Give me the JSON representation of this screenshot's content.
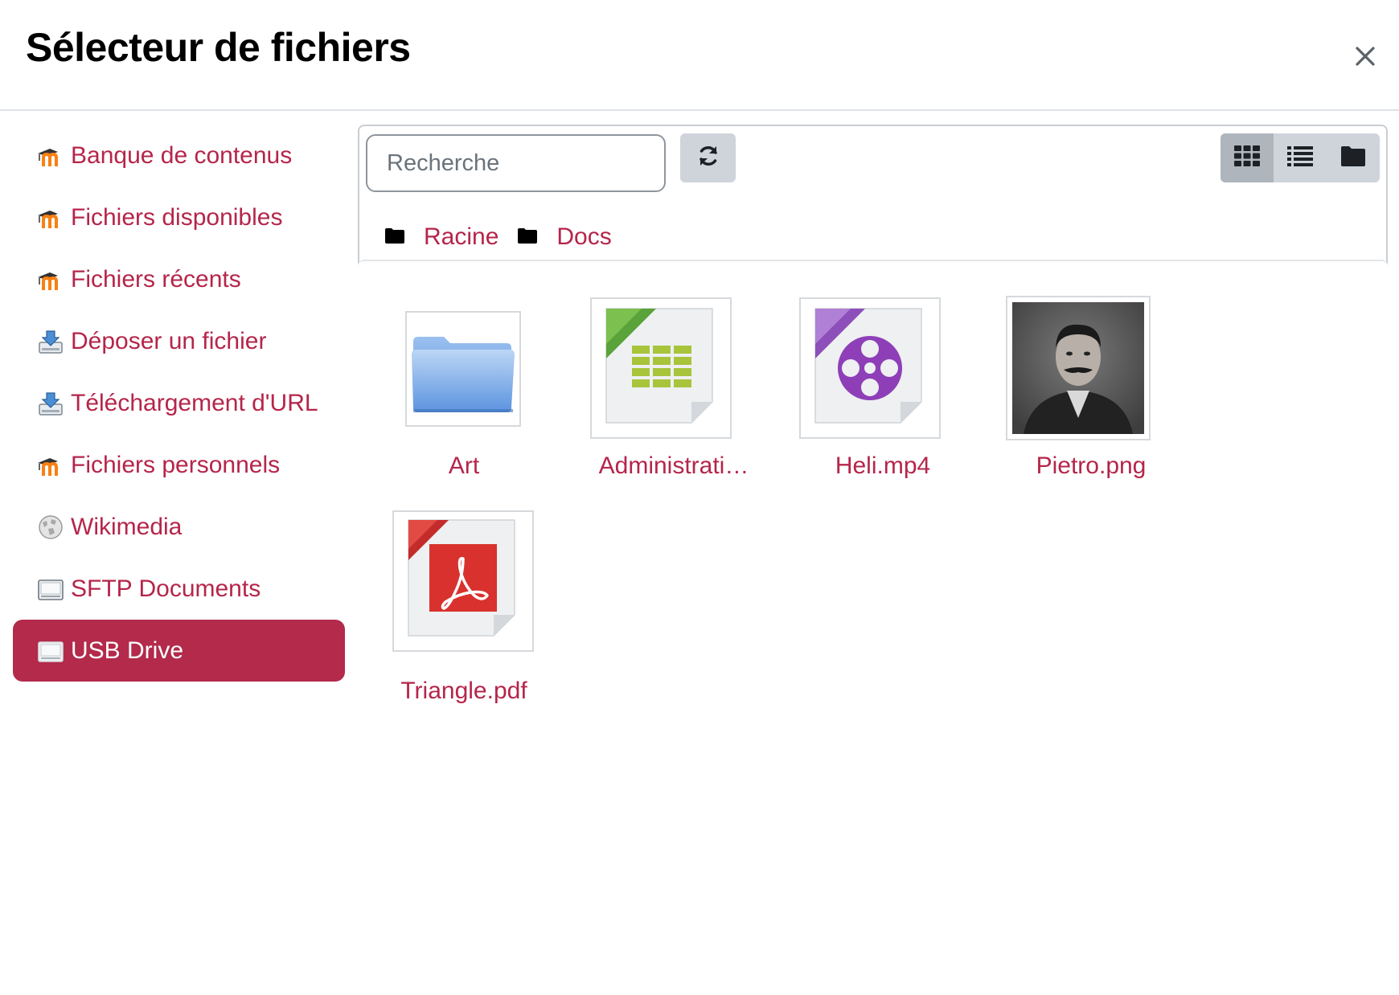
{
  "header": {
    "title": "Sélecteur de fichiers",
    "close_icon": "close-icon"
  },
  "sidebar": {
    "items": [
      {
        "label": "Banque de contenus",
        "icon": "moodle-icon",
        "active": false
      },
      {
        "label": "Fichiers disponibles",
        "icon": "moodle-icon",
        "active": false
      },
      {
        "label": "Fichiers récents",
        "icon": "moodle-icon",
        "active": false
      },
      {
        "label": "Déposer un fichier",
        "icon": "upload-icon",
        "active": false
      },
      {
        "label": "Téléchargement d'URL",
        "icon": "upload-icon",
        "active": false
      },
      {
        "label": "Fichiers personnels",
        "icon": "moodle-icon",
        "active": false
      },
      {
        "label": "Wikimedia",
        "icon": "wikimedia-globe-icon",
        "active": false
      },
      {
        "label": "SFTP Documents",
        "icon": "drive-icon",
        "active": false
      },
      {
        "label": "USB Drive",
        "icon": "drive-icon",
        "active": true
      }
    ]
  },
  "toolbar": {
    "search_placeholder": "Recherche",
    "refresh_icon": "refresh-icon",
    "views": [
      {
        "icon": "grid-view-icon",
        "active": true
      },
      {
        "icon": "list-view-icon",
        "active": false
      },
      {
        "icon": "tree-view-icon",
        "active": false
      }
    ]
  },
  "breadcrumb": [
    {
      "label": "Racine",
      "icon": "folder-icon"
    },
    {
      "label": "Docs",
      "icon": "folder-icon"
    }
  ],
  "files": [
    {
      "name": "Art",
      "type": "folder"
    },
    {
      "name": "Administrati…",
      "type": "spreadsheet"
    },
    {
      "name": "Heli.mp4",
      "type": "video"
    },
    {
      "name": "Pietro.png",
      "type": "image"
    },
    {
      "name": "Triangle.pdf",
      "type": "pdf"
    }
  ],
  "colors": {
    "accent": "#b32a4b",
    "link": "#b5254a"
  }
}
